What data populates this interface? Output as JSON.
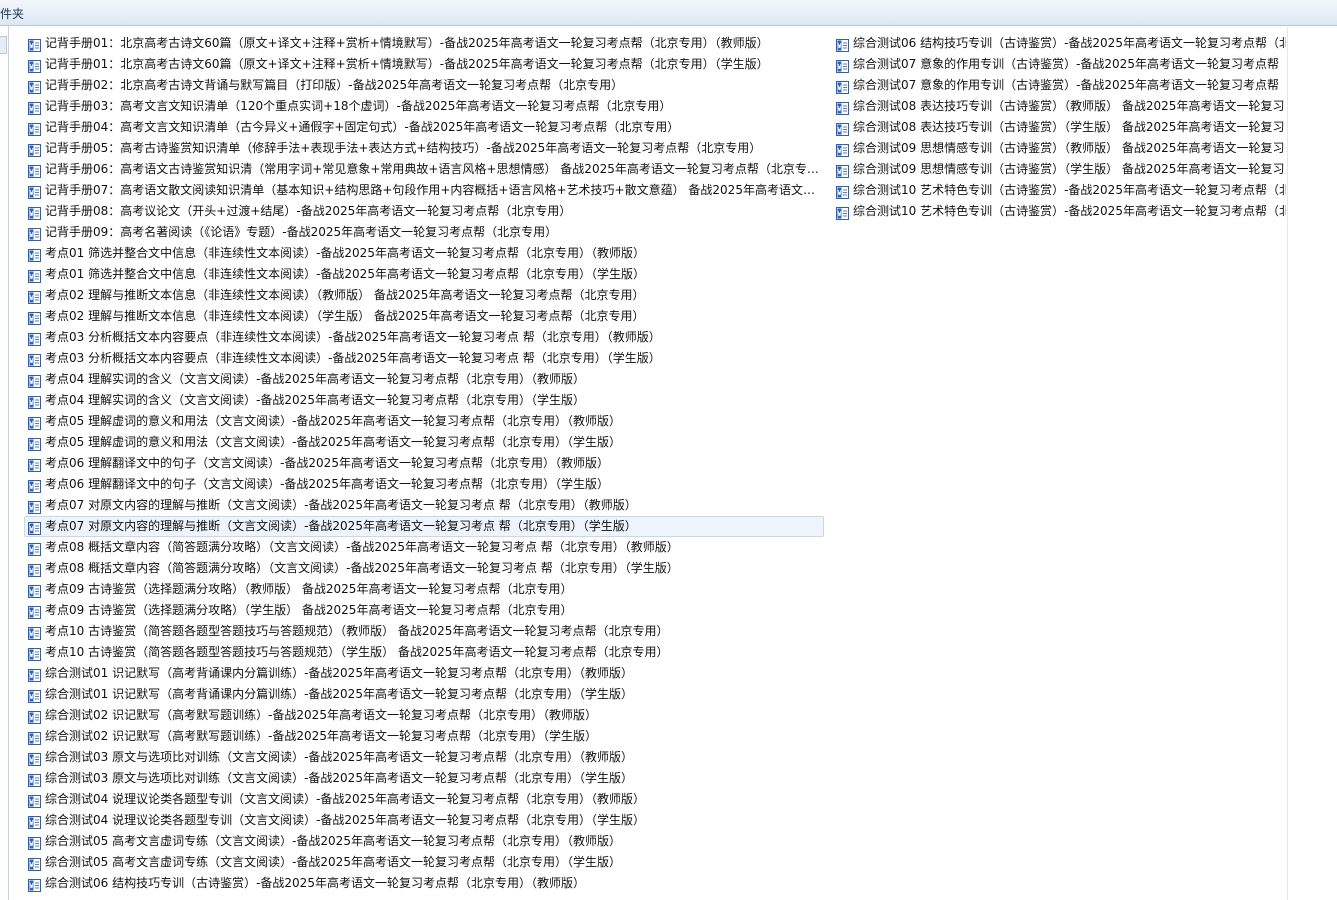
{
  "window": {
    "title": "件夹"
  },
  "icons": {
    "file": "word-document-icon"
  },
  "colors": {
    "icon_blue": "#2b5fb8",
    "selection_bg": "#eef4fb"
  },
  "files_column1": [
    "记背手册01：北京高考古诗文60篇（原文+译文+注释+赏析+情境默写）-备战2025年高考语文一轮复习考点帮（北京专用）（教师版）",
    "记背手册01：北京高考古诗文60篇（原文+译文+注释+赏析+情境默写）-备战2025年高考语文一轮复习考点帮（北京专用）（学生版）",
    "记背手册02：北京高考古诗文背诵与默写篇目（打印版）-备战2025年高考语文一轮复习考点帮（北京专用）",
    "记背手册03：高考文言文知识清单（120个重点实词+18个虚词）-备战2025年高考语文一轮复习考点帮（北京专用）",
    "记背手册04：高考文言文知识清单（古今异义+通假字+固定句式）-备战2025年高考语文一轮复习考点帮（北京专用）",
    "记背手册05：高考古诗鉴赏知识清单（修辞手法+表现手法+表达方式+结构技巧）-备战2025年高考语文一轮复习考点帮（北京专用）",
    "记背手册06：高考语文古诗鉴赏知识清（常用字词+常见意象+常用典故+语言风格+思想情感） 备战2025年高考语文一轮复习考点帮（北京专用）",
    "记背手册07：高考语文散文阅读知识清单（基本知识+结构思路+句段作用+内容概括+语言风格+艺术技巧+散文意蕴） 备战2025年高考语文一轮复习考点帮",
    "记背手册08：高考议论文（开头+过渡+结尾）-备战2025年高考语文一轮复习考点帮（北京专用）",
    "记背手册09：高考名著阅读（《论语》专题）-备战2025年高考语文一轮复习考点帮（北京专用）",
    "考点01 筛选并整合文中信息（非连续性文本阅读）-备战2025年高考语文一轮复习考点帮（北京专用）（教师版）",
    "考点01 筛选并整合文中信息（非连续性文本阅读）-备战2025年高考语文一轮复习考点帮（北京专用）（学生版）",
    "考点02 理解与推断文本信息（非连续性文本阅读）（教师版） 备战2025年高考语文一轮复习考点帮（北京专用）",
    "考点02 理解与推断文本信息（非连续性文本阅读）（学生版） 备战2025年高考语文一轮复习考点帮（北京专用）",
    "考点03 分析概括文本内容要点（非连续性文本阅读）-备战2025年高考语文一轮复习考点 帮（北京专用）（教师版）",
    "考点03 分析概括文本内容要点（非连续性文本阅读）-备战2025年高考语文一轮复习考点 帮（北京专用）（学生版）",
    "考点04 理解实词的含义（文言文阅读）-备战2025年高考语文一轮复习考点帮（北京专用）（教师版）",
    "考点04 理解实词的含义（文言文阅读）-备战2025年高考语文一轮复习考点帮（北京专用）（学生版）",
    "考点05 理解虚词的意义和用法（文言文阅读）-备战2025年高考语文一轮复习考点帮（北京专用）（教师版）",
    "考点05 理解虚词的意义和用法（文言文阅读）-备战2025年高考语文一轮复习考点帮（北京专用）（学生版）",
    "考点06 理解翻译文中的句子（文言文阅读）-备战2025年高考语文一轮复习考点帮（北京专用）（教师版）",
    "考点06 理解翻译文中的句子（文言文阅读）-备战2025年高考语文一轮复习考点帮（北京专用）（学生版）",
    "考点07 对原文内容的理解与推断（文言文阅读）-备战2025年高考语文一轮复习考点 帮（北京专用）（教师版）",
    "考点07 对原文内容的理解与推断（文言文阅读）-备战2025年高考语文一轮复习考点 帮（北京专用）（学生版）",
    "考点08 概括文章内容（简答题满分攻略）（文言文阅读）-备战2025年高考语文一轮复习考点 帮（北京专用）（教师版）",
    "考点08 概括文章内容（简答题满分攻略）（文言文阅读）-备战2025年高考语文一轮复习考点 帮（北京专用）（学生版）",
    "考点09 古诗鉴赏（选择题满分攻略）（教师版） 备战2025年高考语文一轮复习考点帮（北京专用）",
    "考点09 古诗鉴赏（选择题满分攻略）（学生版） 备战2025年高考语文一轮复习考点帮（北京专用）",
    "考点10 古诗鉴赏（简答题各题型答题技巧与答题规范）（教师版） 备战2025年高考语文一轮复习考点帮（北京专用）",
    "考点10 古诗鉴赏（简答题各题型答题技巧与答题规范）（学生版） 备战2025年高考语文一轮复习考点帮（北京专用）",
    "综合测试01 识记默写（高考背诵课内分篇训练）-备战2025年高考语文一轮复习考点帮（北京专用）（教师版）",
    "综合测试01 识记默写（高考背诵课内分篇训练）-备战2025年高考语文一轮复习考点帮（北京专用）（学生版）",
    "综合测试02 识记默写（高考默写题训练）-备战2025年高考语文一轮复习考点帮（北京专用）（教师版）",
    "综合测试02 识记默写（高考默写题训练）-备战2025年高考语文一轮复习考点帮（北京专用）（学生版）",
    "综合测试03 原文与选项比对训练（文言文阅读）-备战2025年高考语文一轮复习考点帮（北京专用）（教师版）",
    "综合测试03 原文与选项比对训练（文言文阅读）-备战2025年高考语文一轮复习考点帮（北京专用）（学生版）",
    "综合测试04 说理议论类各题型专训（文言文阅读）-备战2025年高考语文一轮复习考点帮（北京专用）（教师版）",
    "综合测试04 说理议论类各题型专训（文言文阅读）-备战2025年高考语文一轮复习考点帮（北京专用）（学生版）",
    "综合测试05 高考文言虚词专练（文言文阅读）-备战2025年高考语文一轮复习考点帮（北京专用）（教师版）",
    "综合测试05 高考文言虚词专练（文言文阅读）-备战2025年高考语文一轮复习考点帮（北京专用）（学生版）",
    "综合测试06 结构技巧专训（古诗鉴赏）-备战2025年高考语文一轮复习考点帮（北京专用）（教师版）"
  ],
  "files_column2": [
    "综合测试06 结构技巧专训（古诗鉴赏）-备战2025年高考语文一轮复习考点帮（北",
    "综合测试07 意象的作用专训（古诗鉴赏）-备战2025年高考语文一轮复习考点帮（",
    "综合测试07 意象的作用专训（古诗鉴赏）-备战2025年高考语文一轮复习考点帮（",
    "综合测试08 表达技巧专训（古诗鉴赏）（教师版） 备战2025年高考语文一轮复习",
    "综合测试08 表达技巧专训（古诗鉴赏）（学生版） 备战2025年高考语文一轮复习",
    "综合测试09 思想情感专训（古诗鉴赏）（教师版） 备战2025年高考语文一轮复习",
    "综合测试09 思想情感专训（古诗鉴赏）（学生版） 备战2025年高考语文一轮复习",
    "综合测试10 艺术特色专训（古诗鉴赏）-备战2025年高考语文一轮复习考点帮（北",
    "综合测试10 艺术特色专训（古诗鉴赏）-备战2025年高考语文一轮复习考点帮（北"
  ],
  "selected": {
    "column": 1,
    "index": 23
  }
}
